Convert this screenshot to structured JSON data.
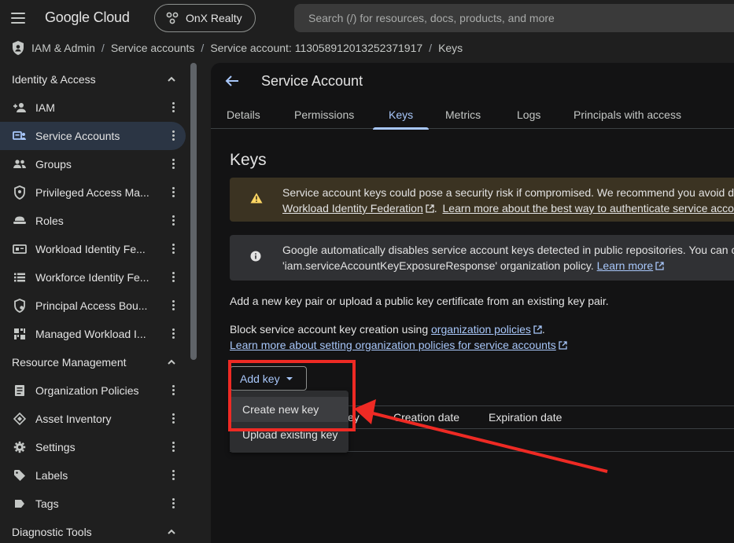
{
  "topbar": {
    "brand": "Google Cloud",
    "project": "OnX Realty",
    "search_placeholder": "Search (/) for resources, docs, products, and more"
  },
  "breadcrumb": [
    "IAM & Admin",
    "Service accounts",
    "Service account: 113058912013252371917",
    "Keys"
  ],
  "breadcrumb_separator": "/",
  "sidebar": {
    "sections": [
      {
        "title": "Identity & Access",
        "items": [
          {
            "label": "IAM",
            "icon": "add-person-icon"
          },
          {
            "label": "Service Accounts",
            "icon": "service-account-icon",
            "active": true
          },
          {
            "label": "Groups",
            "icon": "groups-icon"
          },
          {
            "label": "Privileged Access Ma...",
            "icon": "shield-icon"
          },
          {
            "label": "Roles",
            "icon": "roles-icon"
          },
          {
            "label": "Workload Identity Fe...",
            "icon": "id-card-icon"
          },
          {
            "label": "Workforce Identity Fe...",
            "icon": "list-icon"
          },
          {
            "label": "Principal Access Bou...",
            "icon": "principal-access-icon"
          },
          {
            "label": "Managed Workload I...",
            "icon": "grid-icon"
          }
        ]
      },
      {
        "title": "Resource Management",
        "items": [
          {
            "label": "Organization Policies",
            "icon": "policy-icon"
          },
          {
            "label": "Asset Inventory",
            "icon": "diamond-icon"
          },
          {
            "label": "Settings",
            "icon": "gear-icon"
          },
          {
            "label": "Labels",
            "icon": "label-icon"
          },
          {
            "label": "Tags",
            "icon": "tag-icon"
          }
        ]
      },
      {
        "title": "Diagnostic Tools",
        "items": []
      }
    ]
  },
  "main": {
    "title": "Service Account",
    "tabs": [
      "Details",
      "Permissions",
      "Keys",
      "Metrics",
      "Logs",
      "Principals with access"
    ],
    "active_tab": "Keys",
    "section_title": "Keys",
    "warning_banner": {
      "line1": "Service account keys could pose a security risk if compromised. We recommend you avoid d",
      "link1": "Workload Identity Federation",
      "link2": "Learn more about the best way to authenticate service accou"
    },
    "info_banner": {
      "line1": "Google automatically disables service account keys detected in public repositories. You can c",
      "line2_prefix": "'iam.serviceAccountKeyExposureResponse' organization policy.",
      "link": "Learn more"
    },
    "add_key_text": "Add a new key pair or upload a public key certificate from an existing key pair.",
    "block_text_prefix": "Block service account key creation using",
    "block_link": "organization policies",
    "block_text_suffix": ".",
    "learn_more_org_link": "Learn more about setting organization policies for service accounts",
    "add_key_button": "Add key",
    "table_headers": [
      "Key",
      "Creation date",
      "Expiration date"
    ],
    "table_header_visible_fragment": "ey",
    "dropdown_items": [
      "Create new key",
      "Upload existing key"
    ]
  },
  "colors": {
    "background": "#1f1f1f",
    "main_background": "#131314",
    "accent": "#a8c7fa",
    "warning_bg": "#3b3322",
    "warning_icon": "#fdd663",
    "annotation_red": "#ee2a24"
  }
}
